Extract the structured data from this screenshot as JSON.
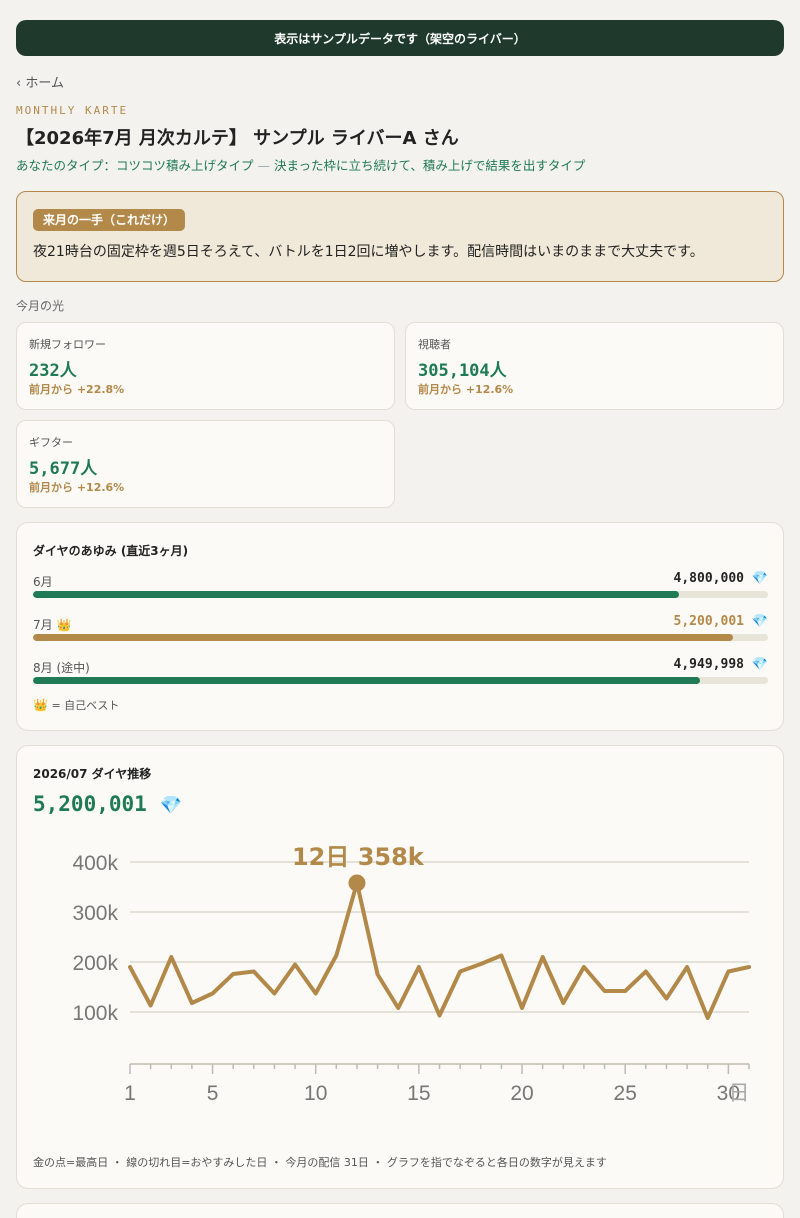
{
  "banner": "表示はサンプルデータです（架空のライバー）",
  "nav": {
    "back": "‹ ホーム"
  },
  "eyebrow": "MONTHLY KARTE",
  "title": "【2026年7月 月次カルテ】 サンプル ライバーA さん",
  "type": {
    "prefix": "あなたのタイプ：コツコツ積み上げタイプ",
    "dash": " — ",
    "desc": "決まった枠に立ち続けて、積み上げで結果を出すタイプ"
  },
  "next_move": {
    "tag": "来月の一手（これだけ）",
    "text": "夜21時台の固定枠を週5日そろえて、バトルを1日2回に増やします。配信時間はいまのままで大丈夫です。"
  },
  "highlights": {
    "label": "今月の光",
    "stats": [
      {
        "label": "新規フォロワー",
        "value": "232",
        "unit": "人",
        "change": "前月から +22.8%"
      },
      {
        "label": "視聴者",
        "value": "305,104",
        "unit": "人",
        "change": "前月から +12.6%"
      },
      {
        "label": "ギフター",
        "value": "5,677",
        "unit": "人",
        "change": "前月から +12.6%"
      }
    ]
  },
  "diamond_history": {
    "title": "ダイヤのあゆみ (直近3ヶ月)",
    "months": [
      {
        "label": "6月",
        "value": "4,800,000",
        "fraction": 0.879,
        "best": false
      },
      {
        "label": "7月",
        "value": "5,200,001",
        "fraction": 0.952,
        "best": true
      },
      {
        "label": "8月 (途中)",
        "value": "4,949,998",
        "fraction": 0.907,
        "best": false
      }
    ],
    "legend": "= 自己ベスト",
    "colors": {
      "normal": "#1f7a55",
      "best": "#b3894a"
    }
  },
  "trend": {
    "title": "2026/07 ダイヤ推移",
    "total": "5,200,001",
    "footnote": "金の点=最高日 ・ 線の切れ目=おやすみした日 ・ 今月の配信 31日 ・ グラフを指でなぞると各日の数字が見えます"
  },
  "chart_data": {
    "type": "line",
    "x": [
      1,
      2,
      3,
      4,
      5,
      6,
      7,
      8,
      9,
      10,
      11,
      12,
      13,
      14,
      15,
      16,
      17,
      18,
      19,
      20,
      21,
      22,
      23,
      24,
      25,
      26,
      27,
      28,
      29,
      30,
      31
    ],
    "series": [
      {
        "values": [
          190,
          113,
          210,
          118,
          137,
          176,
          181,
          137,
          195,
          137,
          213,
          358,
          175,
          108,
          190,
          93,
          181,
          196,
          213,
          108,
          210,
          118,
          190,
          142,
          142,
          181,
          127,
          190,
          88,
          181,
          190
        ]
      }
    ],
    "xticks": [
      1,
      5,
      10,
      15,
      20,
      25,
      30
    ],
    "yticks": [
      100,
      200,
      300,
      400
    ],
    "ytick_labels": [
      "100k",
      "200k",
      "300k",
      "400k"
    ],
    "xunit": "日",
    "peak": {
      "day": 12,
      "label": "12日 358k"
    },
    "ylim": [
      0,
      420
    ],
    "grid": true,
    "line_color": "#b3894a"
  }
}
